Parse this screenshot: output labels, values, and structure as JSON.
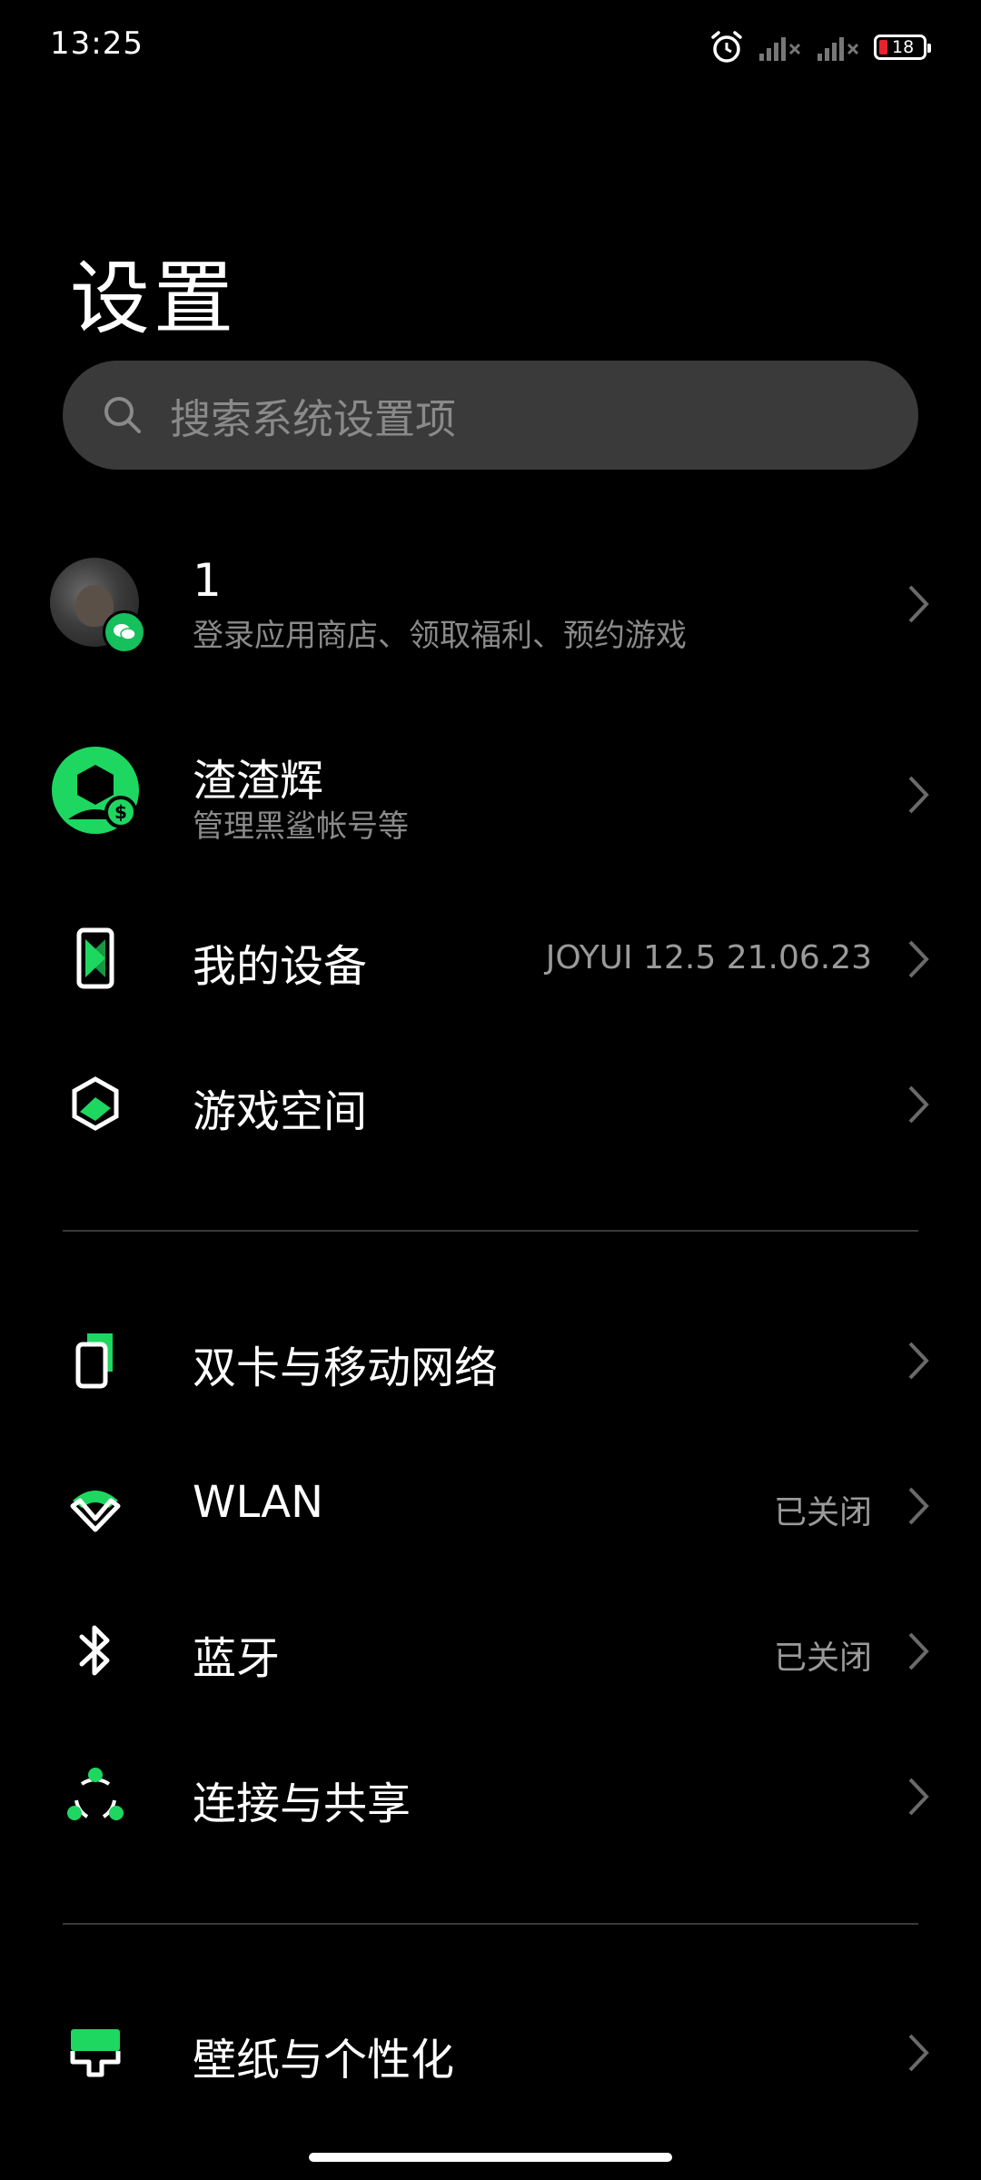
{
  "status_bar": {
    "time": "13:25",
    "battery_level": "18",
    "icons": [
      "alarm-icon",
      "signal-icon",
      "signal-icon",
      "battery-icon"
    ]
  },
  "page": {
    "title": "设置"
  },
  "search": {
    "placeholder": "搜索系统设置项"
  },
  "account": {
    "name": "1",
    "subtitle": "登录应用商店、领取福利、预约游戏"
  },
  "shark_account": {
    "name": "渣渣辉",
    "subtitle": "管理黑鲨帐号等"
  },
  "items": [
    {
      "label": "我的设备",
      "value": "JOYUI 12.5 21.06.23",
      "icon": "phone-device-icon"
    },
    {
      "label": "游戏空间",
      "value": "",
      "icon": "game-space-icon"
    },
    {
      "label": "双卡与移动网络",
      "value": "",
      "icon": "sim-card-icon"
    },
    {
      "label": "WLAN",
      "value": "已关闭",
      "icon": "wifi-icon"
    },
    {
      "label": "蓝牙",
      "value": "已关闭",
      "icon": "bluetooth-icon"
    },
    {
      "label": "连接与共享",
      "value": "",
      "icon": "share-icon"
    },
    {
      "label": "壁纸与个性化",
      "value": "",
      "icon": "wallpaper-icon"
    }
  ],
  "colors": {
    "accent": "#1ed760",
    "background": "#000000",
    "battery_low": "#e8232d"
  }
}
